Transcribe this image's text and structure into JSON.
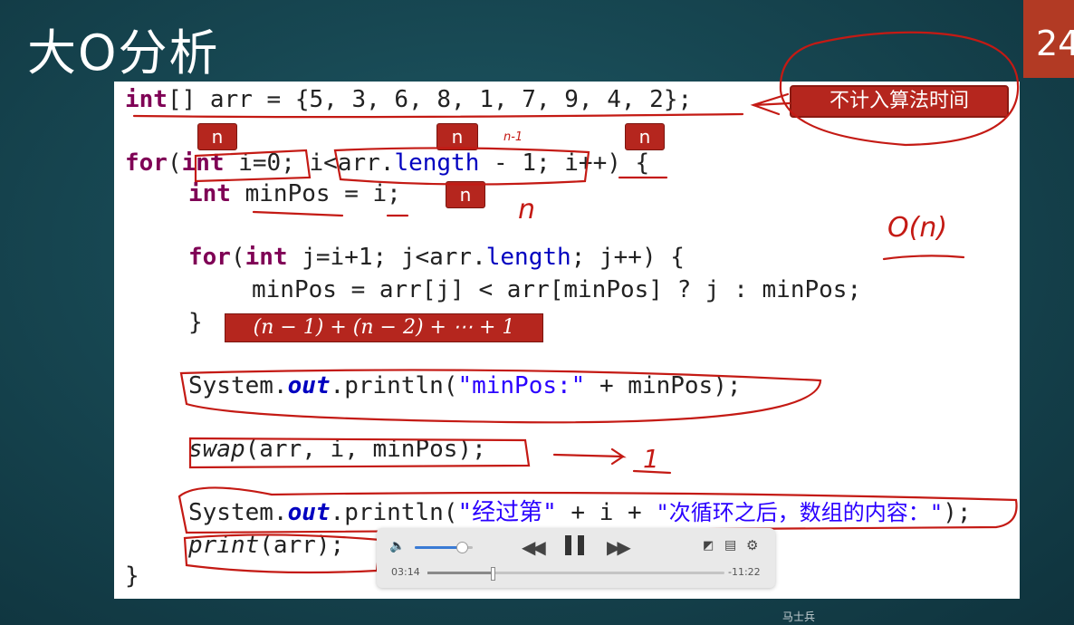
{
  "slide": {
    "title": "大O分析",
    "page_number": "24"
  },
  "code": {
    "l1": {
      "kw": "int",
      "rest": "[] arr = {5, 3, 6, 8, 1, 7, 9, 4, 2};"
    },
    "l2": {
      "kw1": "for",
      "p1": "(",
      "kw2": "int",
      "p2": " i=0; i<arr.",
      "fld": "length",
      "p3": " - 1; i++) {"
    },
    "l3": {
      "kw": "int",
      "rest": " minPos = i;"
    },
    "l4": {
      "kw1": "for",
      "p1": "(",
      "kw2": "int",
      "p2": " j=i+1; j<arr.",
      "fld": "length",
      "p3": "; j++) {"
    },
    "l5": {
      "text": "minPos = arr[j] < arr[minPos] ? j : minPos;"
    },
    "l6": {
      "text": "}"
    },
    "l7": {
      "p1": "System.",
      "out": "out",
      "p2": ".println(",
      "str": "\"minPos:\"",
      "p3": " + minPos);"
    },
    "l8": {
      "fn": "swap",
      "p": "(arr, i, minPos);"
    },
    "l9": {
      "p1": "System.",
      "out": "out",
      "p2": ".println(",
      "str1": "\"经过第\"",
      "p3": " + i + ",
      "str2": "\"次循环之后，数组的内容：\"",
      "p4": ");"
    },
    "l10": {
      "fn": "print",
      "p": "(arr);"
    },
    "l11": {
      "text": "}"
    }
  },
  "annotations": {
    "n_tag": "n",
    "note": "不计入算法时间",
    "formula": "(𝑛 − 1) + (𝑛 − 2) + ⋯ + 1",
    "hand_n_minus_1": "n-1",
    "hand_n": "n",
    "hand_on": "O(n)",
    "hand_1": "1"
  },
  "player": {
    "elapsed": "03:14",
    "remaining": "-11:22",
    "volume_level": 0.82,
    "progress": 0.22,
    "icons": [
      "volume-icon",
      "rewind-icon",
      "pause-icon",
      "fast-forward-icon",
      "pip-icon",
      "chapters-icon",
      "settings-icon"
    ]
  },
  "watermark": "马士兵",
  "colors": {
    "accent_red": "#b5261e",
    "ink": "#c41a14",
    "keyword": "#7f0055",
    "string": "#2a00ff"
  }
}
